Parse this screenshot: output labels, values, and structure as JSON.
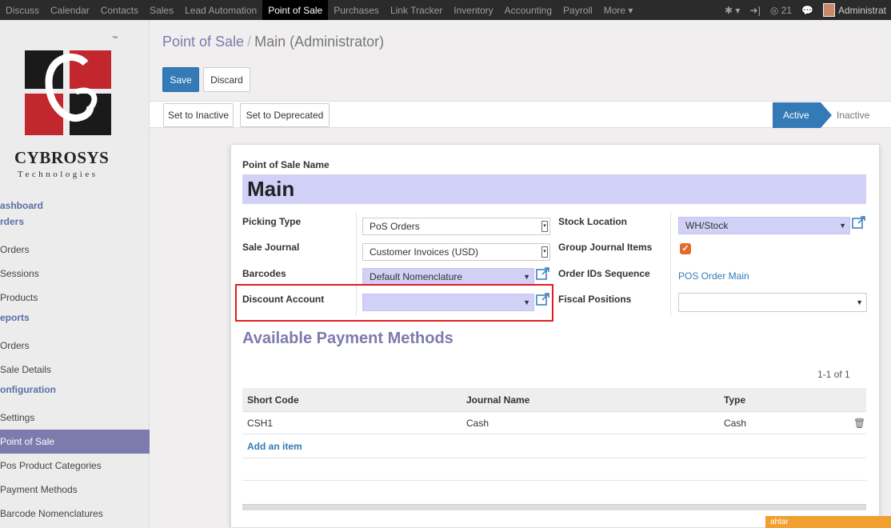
{
  "topbar": {
    "menu": [
      "Discuss",
      "Calendar",
      "Contacts",
      "Sales",
      "Lead Automation",
      "Point of Sale",
      "Purchases",
      "Link Tracker",
      "Inventory",
      "Accounting",
      "Payroll",
      "More ▾"
    ],
    "active_index": 5,
    "notif_count": "21",
    "user": "Administrat"
  },
  "sidebar": {
    "brand": "CYBROSYS",
    "brand_sub": "Technologies",
    "tm": "™",
    "items": [
      {
        "label": "ashboard",
        "type": "section"
      },
      {
        "label": "rders",
        "type": "section"
      },
      {
        "label": "Orders",
        "type": "item"
      },
      {
        "label": "Sessions",
        "type": "item"
      },
      {
        "label": "Products",
        "type": "item"
      },
      {
        "label": "eports",
        "type": "section"
      },
      {
        "label": "Orders",
        "type": "item"
      },
      {
        "label": "Sale Details",
        "type": "item"
      },
      {
        "label": "onfiguration",
        "type": "section"
      },
      {
        "label": "Settings",
        "type": "item"
      },
      {
        "label": "Point of Sale",
        "type": "item",
        "active": true
      },
      {
        "label": "Pos Product Categories",
        "type": "item"
      },
      {
        "label": "Payment Methods",
        "type": "item"
      },
      {
        "label": "Barcode Nomenclatures",
        "type": "item"
      }
    ]
  },
  "breadcrumb": {
    "root": "Point of Sale",
    "sep": "/",
    "current": "Main (Administrator)"
  },
  "buttons": {
    "save": "Save",
    "discard": "Discard",
    "set_inactive": "Set to Inactive",
    "set_deprecated": "Set to Deprecated"
  },
  "stages": {
    "active": "Active",
    "inactive": "Inactive"
  },
  "form": {
    "name_label": "Point of Sale Name",
    "name_value": "Main",
    "picking_type_label": "Picking Type",
    "picking_type_value": "PoS Orders",
    "sale_journal_label": "Sale Journal",
    "sale_journal_value": "Customer Invoices (USD)",
    "barcodes_label": "Barcodes",
    "barcodes_value": "Default Nomenclature",
    "discount_account_label": "Discount Account",
    "discount_account_value": "",
    "stock_location_label": "Stock Location",
    "stock_location_value": "WH/Stock",
    "group_journal_label": "Group Journal Items",
    "group_journal_checked": true,
    "order_seq_label": "Order IDs Sequence",
    "order_seq_value": "POS Order Main",
    "fiscal_positions_label": "Fiscal Positions",
    "fiscal_positions_value": ""
  },
  "payments": {
    "title": "Available Payment Methods",
    "pager": "1-1 of 1",
    "columns": [
      "Short Code",
      "Journal Name",
      "Type"
    ],
    "rows": [
      {
        "short_code": "CSH1",
        "journal": "Cash",
        "type": "Cash"
      }
    ],
    "add_item": "Add an item"
  },
  "chat": {
    "label": "ahtar"
  },
  "colors": {
    "accent": "#7c7bad",
    "primary": "#337ab7",
    "highlight": "#e31b23",
    "required": "#d1d1f7"
  }
}
